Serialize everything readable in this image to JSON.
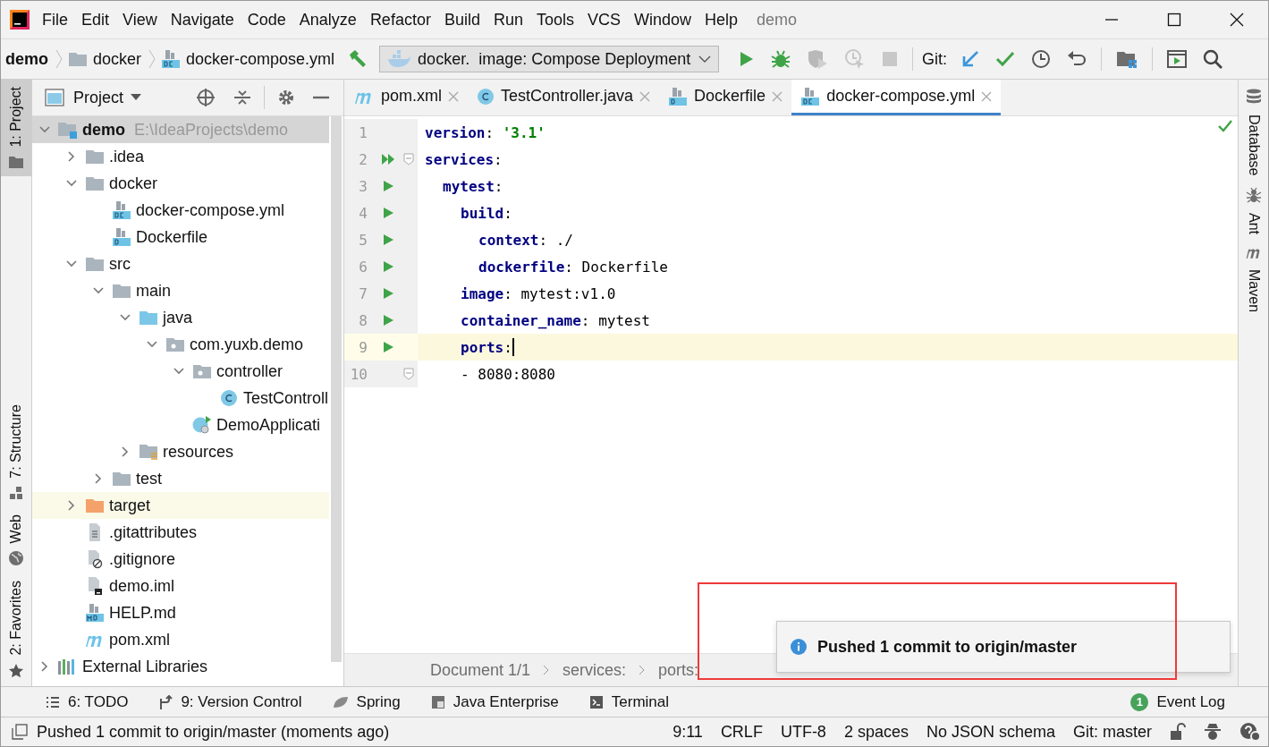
{
  "title_bar": {
    "menus": [
      "File",
      "Edit",
      "View",
      "Navigate",
      "Code",
      "Analyze",
      "Refactor",
      "Build",
      "Run",
      "Tools",
      "VCS",
      "Window",
      "Help"
    ],
    "title": "demo"
  },
  "nav_bar": {
    "breadcrumbs": [
      {
        "label": "demo",
        "kind": "project"
      },
      {
        "label": "docker",
        "kind": "folder"
      },
      {
        "label": "docker-compose.yml",
        "kind": "compose"
      }
    ],
    "run_config": "docker.  image: Compose Deployment",
    "git_label": "Git:"
  },
  "left_tool_windows": [
    {
      "label": "1: Project",
      "kind": "folder",
      "selected": true
    },
    {
      "label": "7: Structure",
      "kind": "structure",
      "selected": false
    },
    {
      "label": "Web",
      "kind": "globe",
      "selected": false
    },
    {
      "label": "2: Favorites",
      "kind": "star",
      "selected": false
    }
  ],
  "right_tool_windows": [
    {
      "label": "Database",
      "kind": "database"
    },
    {
      "label": "Ant",
      "kind": "ant"
    },
    {
      "label": "Maven",
      "kind": "maven"
    }
  ],
  "project_panel": {
    "title": "Project",
    "tree": [
      {
        "name": "demo",
        "path": "E:\\IdeaProjects\\demo",
        "kind": "module",
        "expanded": true,
        "selected": true,
        "highlighted": false,
        "children": [
          {
            "name": ".idea",
            "kind": "folder",
            "expanded": false,
            "selected": false,
            "highlighted": false
          },
          {
            "name": "docker",
            "kind": "folder",
            "expanded": true,
            "selected": false,
            "highlighted": false,
            "children": [
              {
                "name": "docker-compose.yml",
                "kind": "compose",
                "selected": false,
                "highlighted": false
              },
              {
                "name": "Dockerfile",
                "kind": "dockerfile",
                "selected": false,
                "highlighted": false
              }
            ]
          },
          {
            "name": "src",
            "kind": "folder",
            "expanded": true,
            "selected": false,
            "highlighted": false,
            "children": [
              {
                "name": "main",
                "kind": "folder",
                "expanded": true,
                "selected": false,
                "highlighted": false,
                "children": [
                  {
                    "name": "java",
                    "kind": "source",
                    "expanded": true,
                    "selected": false,
                    "highlighted": false,
                    "children": [
                      {
                        "name": "com.yuxb.demo",
                        "kind": "package",
                        "expanded": true,
                        "selected": false,
                        "highlighted": false,
                        "children": [
                          {
                            "name": "controller",
                            "kind": "package",
                            "expanded": true,
                            "selected": false,
                            "highlighted": false,
                            "children": [
                              {
                                "name": "TestControll",
                                "kind": "class",
                                "selected": false,
                                "highlighted": false
                              }
                            ]
                          },
                          {
                            "name": "DemoApplicati",
                            "kind": "spring",
                            "selected": false,
                            "highlighted": false
                          }
                        ]
                      }
                    ]
                  },
                  {
                    "name": "resources",
                    "kind": "resources",
                    "expanded": false,
                    "selected": false,
                    "highlighted": false
                  }
                ]
              },
              {
                "name": "test",
                "kind": "folder",
                "expanded": false,
                "selected": false,
                "highlighted": false
              }
            ]
          },
          {
            "name": "target",
            "kind": "excluded",
            "expanded": false,
            "selected": false,
            "highlighted": true
          },
          {
            "name": ".gitattributes",
            "kind": "text",
            "selected": false,
            "highlighted": false
          },
          {
            "name": ".gitignore",
            "kind": "gitignore",
            "selected": false,
            "highlighted": false
          },
          {
            "name": "demo.iml",
            "kind": "iml",
            "selected": false,
            "highlighted": false
          },
          {
            "name": "HELP.md",
            "kind": "md",
            "selected": false,
            "highlighted": false
          },
          {
            "name": "pom.xml",
            "kind": "maven",
            "selected": false,
            "highlighted": false
          }
        ]
      },
      {
        "name": "External Libraries",
        "kind": "libraries",
        "expanded": false,
        "selected": false,
        "highlighted": false
      }
    ]
  },
  "editor_tabs": [
    {
      "label": "pom.xml",
      "kind": "maven",
      "selected": false
    },
    {
      "label": "TestController.java",
      "kind": "class",
      "selected": false
    },
    {
      "label": "Dockerfile",
      "kind": "dockerfile",
      "selected": false
    },
    {
      "label": "docker-compose.yml",
      "kind": "compose",
      "selected": true
    }
  ],
  "editor": {
    "lines": [
      {
        "number": "1",
        "kind": "plain",
        "fold": false,
        "current": false,
        "parts": [
          {
            "kind": "key",
            "text": "version"
          },
          {
            "kind": "plain",
            "text": ": "
          },
          {
            "kind": "string",
            "text": "'3.1'"
          }
        ]
      },
      {
        "number": "2",
        "kind": "run_all",
        "fold": true,
        "current": false,
        "parts": [
          {
            "kind": "key",
            "text": "services"
          },
          {
            "kind": "plain",
            "text": ":"
          }
        ],
        "children": [
          {
            "number": "3",
            "kind": "run",
            "fold": false,
            "current": false,
            "parts": [
              {
                "kind": "key",
                "text": "mytest"
              },
              {
                "kind": "plain",
                "text": ":"
              }
            ],
            "children": [
              {
                "number": "4",
                "kind": "run",
                "fold": false,
                "current": false,
                "parts": [
                  {
                    "kind": "key",
                    "text": "build"
                  },
                  {
                    "kind": "plain",
                    "text": ":"
                  }
                ],
                "children": [
                  {
                    "number": "5",
                    "kind": "run",
                    "fold": false,
                    "current": false,
                    "parts": [
                      {
                        "kind": "key",
                        "text": "context"
                      },
                      {
                        "kind": "plain",
                        "text": ": ./"
                      }
                    ]
                  },
                  {
                    "number": "6",
                    "kind": "run",
                    "fold": false,
                    "current": false,
                    "parts": [
                      {
                        "kind": "key",
                        "text": "dockerfile"
                      },
                      {
                        "kind": "plain",
                        "text": ": Dockerfile"
                      }
                    ]
                  }
                ]
              },
              {
                "number": "7",
                "kind": "run",
                "fold": false,
                "current": false,
                "parts": [
                  {
                    "kind": "key",
                    "text": "image"
                  },
                  {
                    "kind": "plain",
                    "text": ": mytest:v1.0"
                  }
                ]
              },
              {
                "number": "8",
                "kind": "run",
                "fold": false,
                "current": false,
                "parts": [
                  {
                    "kind": "key",
                    "text": "container_name"
                  },
                  {
                    "kind": "plain",
                    "text": ": mytest"
                  }
                ]
              },
              {
                "number": "9",
                "kind": "run",
                "fold": false,
                "current": true,
                "parts": [
                  {
                    "kind": "key",
                    "text": "ports"
                  },
                  {
                    "kind": "plain",
                    "text": ":"
                  }
                ]
              },
              {
                "number": "10",
                "kind": "plain",
                "fold": true,
                "current": false,
                "parts": [
                  {
                    "kind": "plain",
                    "text": "- 8080:8080"
                  }
                ]
              }
            ]
          }
        ]
      }
    ],
    "breadcrumbs": [
      "Document 1/1",
      "services:",
      "ports:"
    ]
  },
  "notification": {
    "message": "Pushed 1 commit to origin/master"
  },
  "bottom_tool_windows": [
    {
      "label": "6: TODO",
      "kind": "list"
    },
    {
      "label": "9: Version Control",
      "kind": "vcs"
    },
    {
      "label": "Spring",
      "kind": "leaf"
    },
    {
      "label": "Java Enterprise",
      "kind": "enterprise"
    },
    {
      "label": "Terminal",
      "kind": "terminal"
    }
  ],
  "event_log": {
    "count": "1",
    "label": "Event Log"
  },
  "status_bar": {
    "message": "Pushed 1 commit to origin/master (moments ago)",
    "items": [
      "9:11",
      "CRLF",
      "UTF-8",
      "2 spaces",
      "No JSON schema",
      "Git: master"
    ]
  }
}
